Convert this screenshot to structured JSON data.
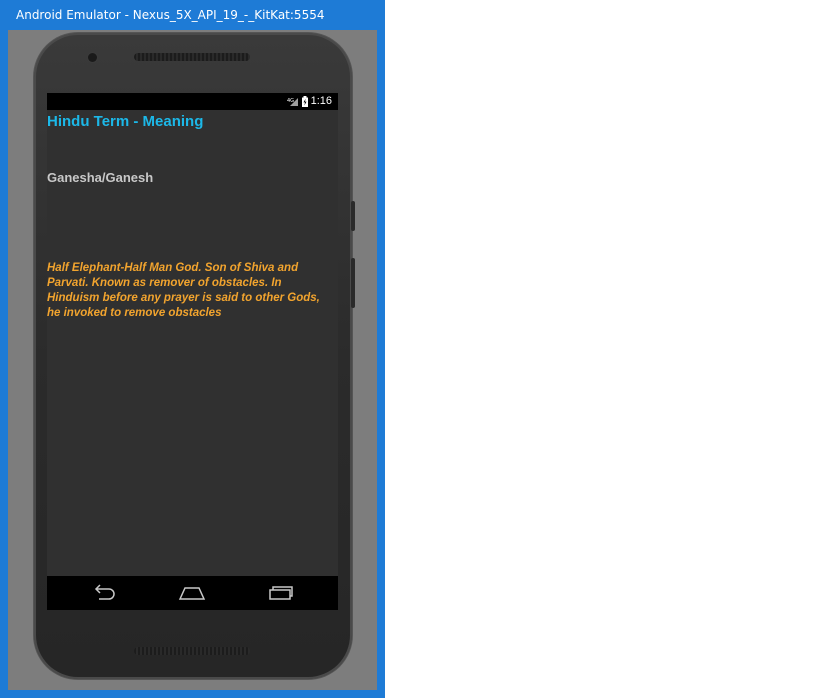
{
  "window": {
    "title": "Android Emulator - Nexus_5X_API_19_-_KitKat:5554"
  },
  "status_bar": {
    "network": "4G",
    "time": "1:16"
  },
  "app": {
    "title": "Hindu Term - Meaning",
    "term": "Ganesha/Ganesh",
    "meaning": "Half Elephant-Half Man God. Son of Shiva and Parvati. Known as remover of obstacles. In Hinduism before any prayer is said to other Gods, he invoked to remove obstacles"
  },
  "colors": {
    "titlebar": "#1e7bd6",
    "app_title": "#1cb8e8",
    "term": "#c8c8c8",
    "meaning": "#f2a42e",
    "screen_bg": "#303030"
  },
  "nav_icons": [
    "back-icon",
    "home-icon",
    "recent-apps-icon"
  ]
}
